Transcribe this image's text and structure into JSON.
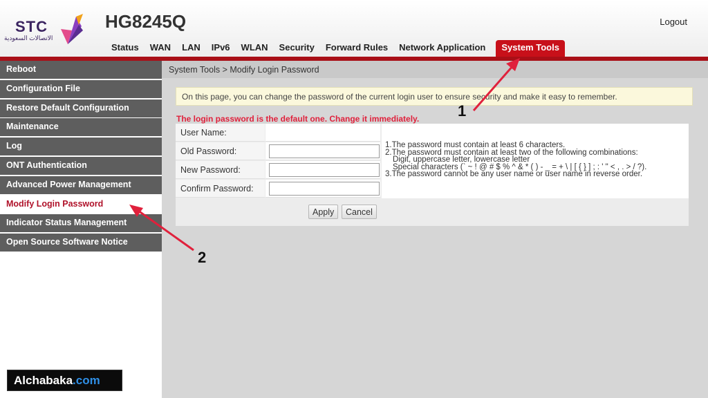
{
  "header": {
    "logo_text": "STC",
    "logo_arabic": "الاتصالات السعودية",
    "model": "HG8245Q",
    "logout": "Logout",
    "tabs": [
      "Status",
      "WAN",
      "LAN",
      "IPv6",
      "WLAN",
      "Security",
      "Forward Rules",
      "Network Application",
      "System Tools"
    ],
    "active_tab": "System Tools"
  },
  "sidebar": {
    "items": [
      {
        "label": "Reboot"
      },
      {
        "label": "Configuration File"
      },
      {
        "label": "Restore Default Configuration"
      },
      {
        "label": "Maintenance"
      },
      {
        "label": "Log"
      },
      {
        "label": "ONT Authentication"
      },
      {
        "label": "Advanced Power Management"
      },
      {
        "label": "Modify Login Password"
      },
      {
        "label": "Indicator Status Management"
      },
      {
        "label": "Open Source Software Notice"
      }
    ],
    "active_item": "Modify Login Password"
  },
  "main": {
    "breadcrumb": "System Tools > Modify Login Password",
    "info": "On this page, you can change the password of the current login user to ensure security and make it easy to remember.",
    "warning": "The login password is the default one. Change it immediately.",
    "form": {
      "user_name_label": "User Name:",
      "user_name_value": "",
      "old_password_label": "Old Password:",
      "new_password_label": "New Password:",
      "confirm_password_label": "Confirm Password:"
    },
    "rules": [
      "1.The password must contain at least 6 characters.",
      "2.The password must contain at least two of the following combinations:",
      "Digit, uppercase letter, lowercase letter",
      "Special characters (` ~ ! @ # $ % ^ & * ( ) - _ = + \\ | [ { } ] ; : ' \" < , . > / ?).",
      "3.The password cannot be any user name or user name in reverse order."
    ],
    "buttons": {
      "apply": "Apply",
      "cancel": "Cancel"
    }
  },
  "annotations": {
    "callout_1": "1",
    "callout_2": "2",
    "arrow_color": "#e0213c"
  },
  "watermark": {
    "name": "Alchabaka",
    "suffix": ".com"
  },
  "colors": {
    "accent_red": "#c8101a",
    "sidebar_bg": "#5e5e5e",
    "active_text": "#b0122a",
    "warning": "#e0213c"
  }
}
